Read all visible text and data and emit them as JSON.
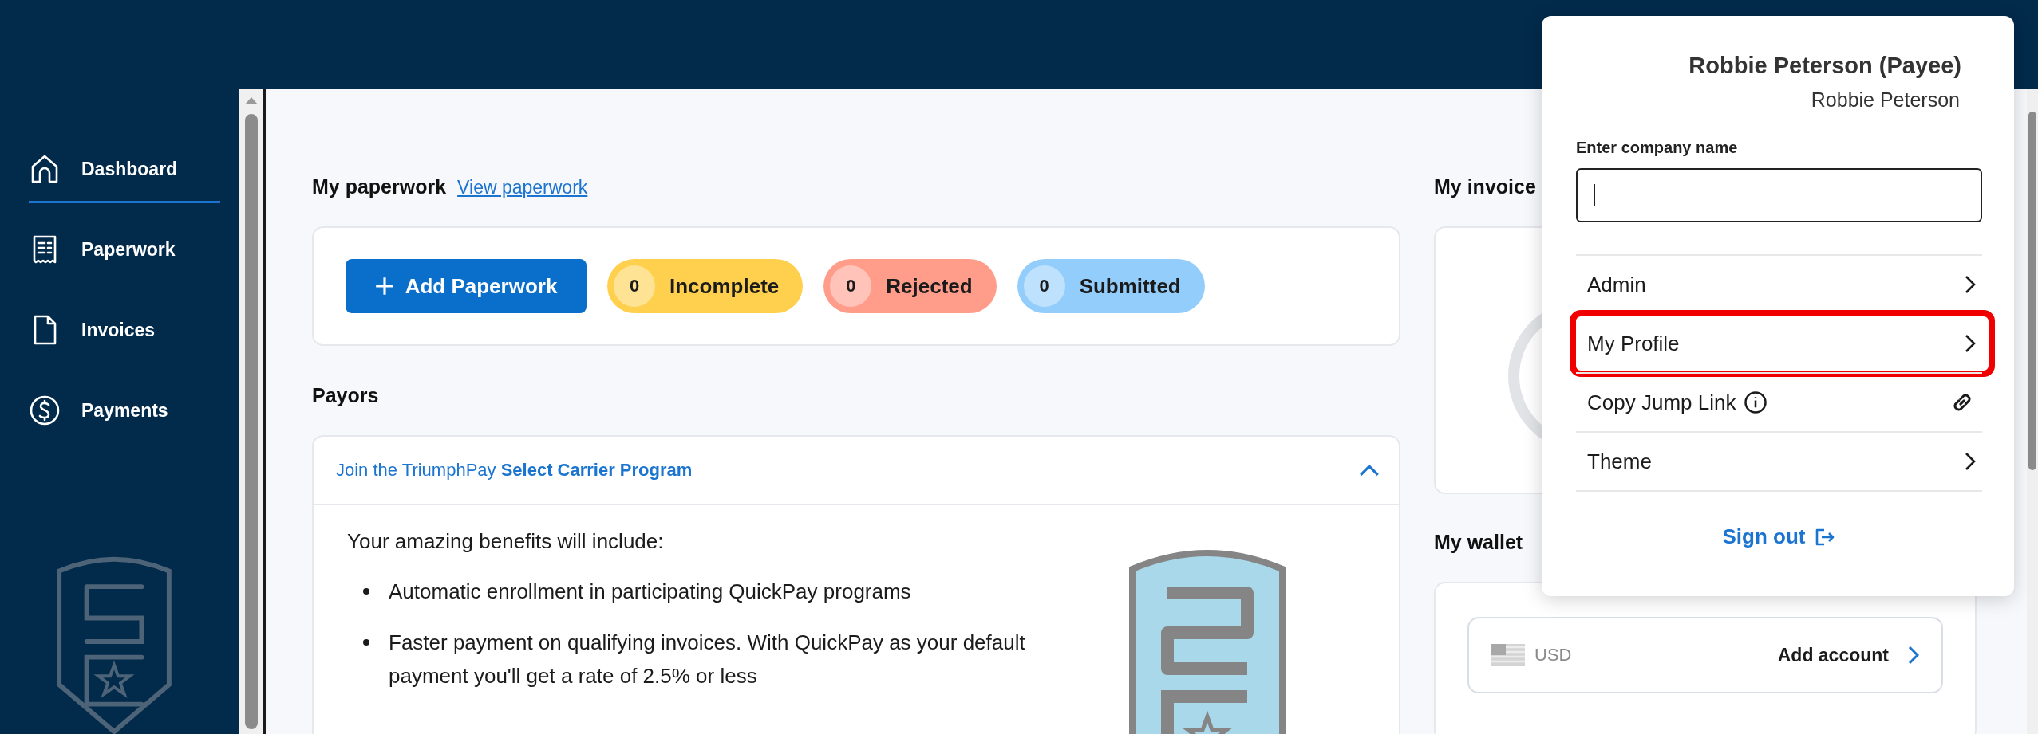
{
  "sidebar": {
    "items": [
      {
        "label": "Dashboard",
        "selected": true
      },
      {
        "label": "Paperwork",
        "selected": false
      },
      {
        "label": "Invoices",
        "selected": false
      },
      {
        "label": "Payments",
        "selected": false
      }
    ]
  },
  "paperwork": {
    "title": "My paperwork",
    "link": "View paperwork",
    "add_button": "Add Paperwork",
    "statuses": [
      {
        "count": "0",
        "label": "Incomplete",
        "color": "#ffd04d"
      },
      {
        "count": "0",
        "label": "Rejected",
        "color": "#ff9c8a"
      },
      {
        "count": "0",
        "label": "Submitted",
        "color": "#93cdfc"
      }
    ]
  },
  "payors": {
    "title": "Payors",
    "banner": {
      "text": "Join the TriumphPay **Select Carrier Program**",
      "expanded": true
    },
    "intro": "Your amazing benefits will include:",
    "benefits": [
      "Automatic enrollment in participating QuickPay programs",
      "Faster payment on qualifying invoices. With QuickPay as your default payment you'll get a rate of 2.5% or less"
    ]
  },
  "invoices": {
    "title": "My invoice"
  },
  "wallet": {
    "title": "My wallet",
    "accounts": [
      {
        "currency": "USD",
        "action": "Add account"
      }
    ]
  },
  "user_menu": {
    "name": "Robbie Peterson (Payee)",
    "subname": "Robbie Peterson",
    "company_field": {
      "label": "Enter company name"
    },
    "items": [
      {
        "label": "Admin",
        "kind": "submenu",
        "highlighted": false
      },
      {
        "label": "My Profile",
        "kind": "submenu",
        "highlighted": true
      },
      {
        "label": "Copy Jump Link",
        "kind": "copy",
        "highlighted": false
      },
      {
        "label": "Theme",
        "kind": "submenu",
        "highlighted": false
      }
    ],
    "sign_out": "Sign out"
  }
}
